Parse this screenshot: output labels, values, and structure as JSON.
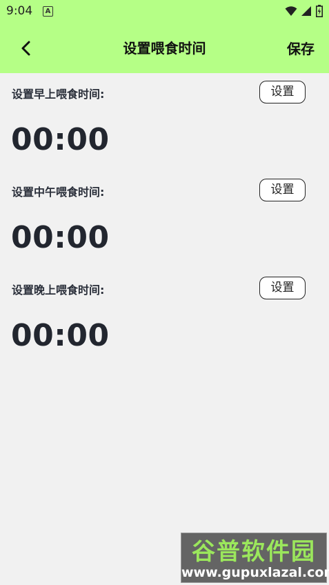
{
  "status_bar": {
    "time": "9:04",
    "notification_icon": "A",
    "icons": [
      "wifi-icon",
      "signal-icon",
      "battery-icon"
    ]
  },
  "app_bar": {
    "back_icon": "chevron-left-icon",
    "title": "设置喂食时间",
    "save_label": "保存",
    "background": "#b5ff86"
  },
  "feeding_times": [
    {
      "label": "设置早上喂食时间:",
      "button_label": "设置",
      "time": "00:00"
    },
    {
      "label": "设置中午喂食时间:",
      "button_label": "设置",
      "time": "00:00"
    },
    {
      "label": "设置晚上喂食时间:",
      "button_label": "设置",
      "time": "00:00"
    }
  ],
  "watermark": {
    "brand": "谷普软件园",
    "url": "www.gupuxlazal.com"
  }
}
